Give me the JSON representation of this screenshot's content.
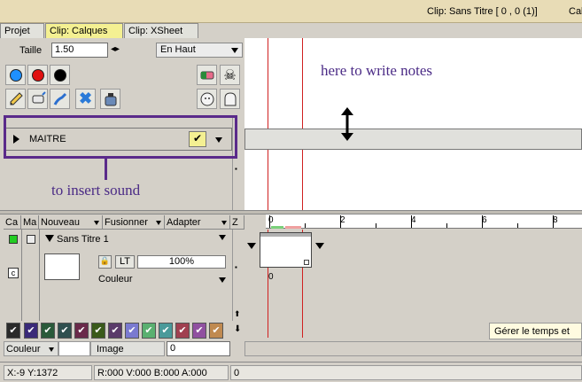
{
  "title": {
    "clip": "Clip: Sans Titre [ 0 , 0  (1)]",
    "right_cut": "Cal"
  },
  "tabs": [
    {
      "label": "Projet",
      "active": false
    },
    {
      "label": "Clip: Calques",
      "active": true
    },
    {
      "label": "Clip: XSheet",
      "active": false
    }
  ],
  "toolbar": {
    "size_label": "Taille",
    "size_value": "1.50",
    "position_value": "En Haut"
  },
  "layer": {
    "name": "MAITRE"
  },
  "annotations": {
    "notes": "here  to  write  notes",
    "sound": "to  insert  sound"
  },
  "columns": {
    "ca": "Ca",
    "ma": "Ma",
    "nouveau": "Nouveau",
    "fusionner": "Fusionner",
    "adapter": "Adapter",
    "z": "Z"
  },
  "level": {
    "name": "Sans Titre 1",
    "lt": "LT",
    "opacity": "100%",
    "color_mode": "Couleur",
    "c_label": "c",
    "frame_num": "0"
  },
  "ruler": {
    "labels": [
      "0",
      "2",
      "4",
      "6",
      "8"
    ]
  },
  "swatches": {
    "colors": [
      "#2a2a2a",
      "#3a2a78",
      "#2a5a3a",
      "#2f4f4f",
      "#6a2a4a",
      "#3a5a1a",
      "#5a3a6a",
      "#7a7ad0",
      "#5ab070",
      "#4a9a9a",
      "#a04050",
      "#9050a0",
      "#c08a50"
    ]
  },
  "bottom": {
    "couleur": "Couleur",
    "image": "Image",
    "image_value": "0"
  },
  "tooltip": "Gérer le temps et",
  "status": {
    "xy": "X:-9  Y:1372",
    "rgba": "R:000 V:000 B:000 A:000",
    "zero": "0"
  }
}
